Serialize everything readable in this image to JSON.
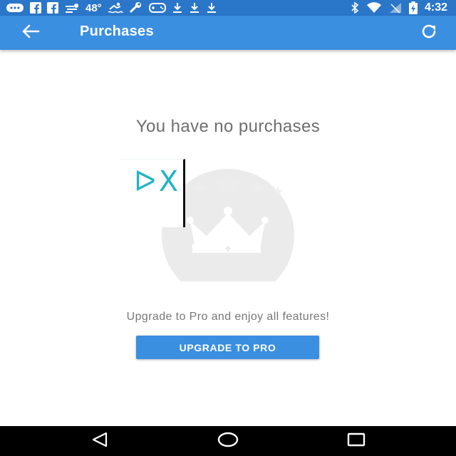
{
  "status_bar": {
    "temperature": "48°",
    "time": "4:32",
    "left_icons": [
      "chat-icon",
      "facebook-icon",
      "facebook-icon",
      "weather-icon",
      "swimmer-icon",
      "wrench-icon",
      "gamepad-icon",
      "download-icon",
      "download-icon",
      "download-icon"
    ],
    "right_icons": [
      "bluetooth-icon",
      "wifi-icon",
      "signal-icon",
      "battery-charging-icon"
    ]
  },
  "app_bar": {
    "title": "Purchases",
    "back_icon": "arrow-back-icon",
    "refresh_icon": "refresh-icon",
    "color": "#3a8fe0"
  },
  "main": {
    "empty_title": "You have no purchases",
    "logo_text": "ᐅX",
    "upgrade_text": "Upgrade to Pro and enjoy all features!",
    "upgrade_button_label": "UPGRADE TO PRO",
    "illustration": "crown-with-stars-icon"
  },
  "nav_bar": {
    "back": "nav-back-icon",
    "home": "nav-home-icon",
    "recents": "nav-recents-icon"
  }
}
